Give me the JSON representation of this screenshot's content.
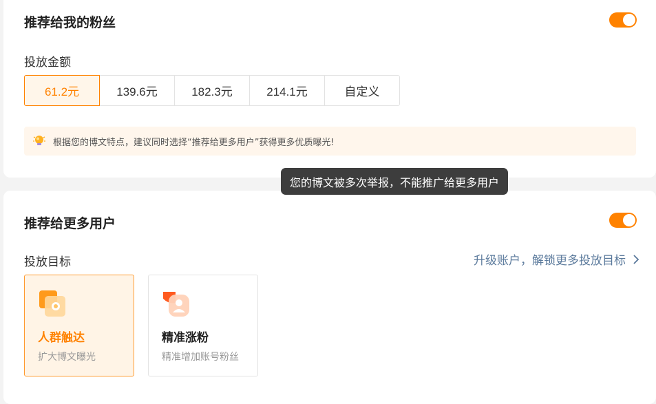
{
  "fans_section": {
    "title": "推荐给我的粉丝",
    "toggle_on": true,
    "amount_label": "投放金额",
    "amounts": [
      "61.2元",
      "139.6元",
      "182.3元",
      "214.1元",
      "自定义"
    ],
    "selected_amount": "61.2元",
    "tip": "根据您的博文特点，建议同时选择“推荐给更多用户”获得更多优质曝光!"
  },
  "tooltip": "您的博文被多次举报，不能推广给更多用户",
  "more_users_section": {
    "title": "推荐给更多用户",
    "toggle_on": true,
    "target_label": "投放目标",
    "upgrade_link": "升级账户，解锁更多投放目标",
    "targets": [
      {
        "name": "人群触达",
        "desc": "扩大博文曝光",
        "icon": "crowd-reach-icon",
        "selected": true
      },
      {
        "name": "精准涨粉",
        "desc": "精准增加账号粉丝",
        "icon": "precise-fans-icon",
        "selected": false
      }
    ]
  },
  "colors": {
    "accent": "#ff8200",
    "selected_bg": "#fff6ea",
    "tip_bg": "#fff6ec",
    "link": "#5b7a9c",
    "tooltip_bg": "#3d3d3d"
  }
}
